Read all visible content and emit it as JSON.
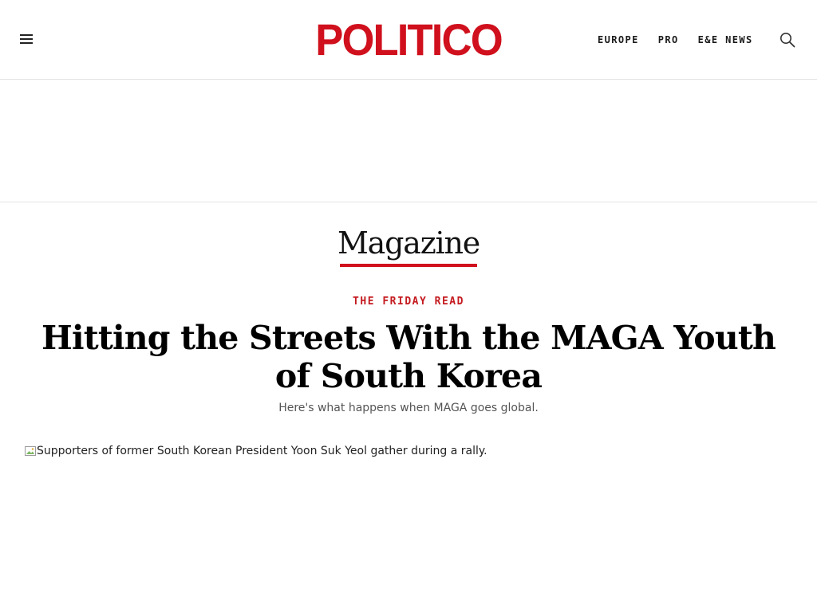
{
  "header": {
    "logo_text": "POLITICO",
    "brand_color": "#d0101d",
    "menu_icon": "hamburger-menu-icon",
    "search_icon": "search-icon",
    "nav": [
      {
        "label": "EUROPE"
      },
      {
        "label": "PRO"
      },
      {
        "label": "E&E NEWS"
      }
    ]
  },
  "section": {
    "name": "Magazine",
    "rule_color": "#d0101d"
  },
  "article": {
    "kicker": "THE FRIDAY READ",
    "headline": "Hitting the Streets With the MAGA Youth of South Korea",
    "dek": "Here's what happens when MAGA goes global.",
    "hero_image_alt": "Supporters of former South Korean President Yoon Suk Yeol gather during a rally."
  }
}
